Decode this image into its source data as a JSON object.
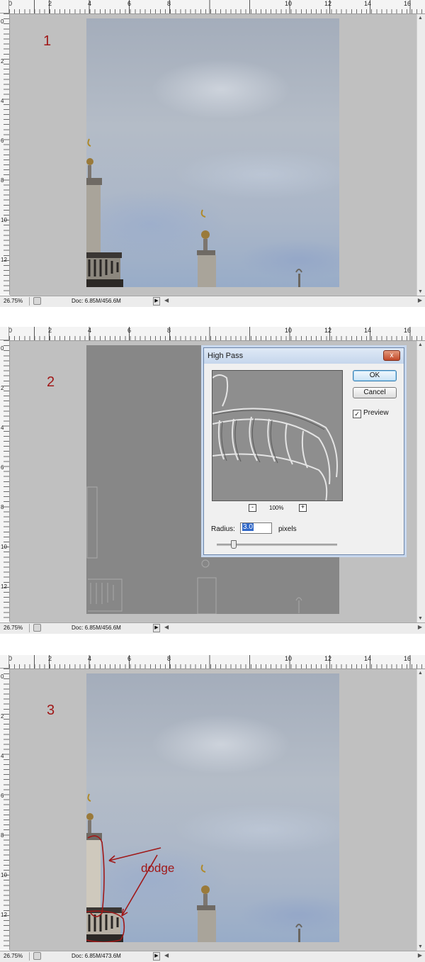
{
  "panels": [
    {
      "step_label": "1",
      "zoom": "26.75%",
      "doc_info": "Doc: 6.85M/456.6M"
    },
    {
      "step_label": "2",
      "zoom": "26.75%",
      "doc_info": "Doc: 6.85M/456.6M",
      "dialog": {
        "title": "High Pass",
        "close_label": "x",
        "ok_label": "OK",
        "cancel_label": "Cancel",
        "preview_label": "Preview",
        "preview_checked": true,
        "zoom_minus": "-",
        "zoom_level": "100%",
        "zoom_plus": "+",
        "radius_label": "Radius:",
        "radius_value": "3.0",
        "radius_unit": "pixels",
        "radius_slider_fraction": 0.05
      }
    },
    {
      "step_label": "3",
      "zoom": "26.75%",
      "doc_info": "Doc: 6.85M/473.6M",
      "annotation": "dodge"
    }
  ],
  "ruler": {
    "horizontal_labels": [
      "0",
      "2",
      "4",
      "6",
      "8",
      "10",
      "12",
      "14",
      "16"
    ],
    "vertical_labels": [
      "0",
      "2",
      "4",
      "6",
      "8",
      "10",
      "12"
    ]
  },
  "colors": {
    "annotation": "#a01818",
    "canvas_bg": "#c0c0c0",
    "dialog_border": "#6b84a8"
  },
  "icons": {
    "status_menu_arrow": "triangle-right",
    "scroll_left": "triangle-left",
    "scroll_right": "triangle-right",
    "scroll_up": "triangle-up",
    "scroll_down": "triangle-down"
  }
}
